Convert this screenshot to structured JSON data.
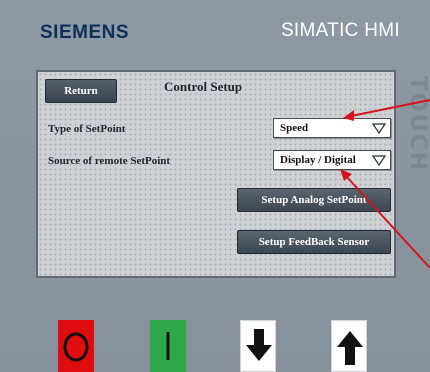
{
  "header": {
    "brand": "SIEMENS",
    "product": "SIMATIC HMI",
    "side_label": "TOUCH"
  },
  "screen": {
    "title": "Control Setup",
    "return_label": "Return",
    "fields": [
      {
        "label": "Type of SetPoint",
        "value": "Speed"
      },
      {
        "label": "Source of remote SetPoint",
        "value": "Display / Digital"
      }
    ],
    "buttons": [
      {
        "label": "Setup Analog SetPoint"
      },
      {
        "label": "Setup FeedBack Sensor"
      }
    ]
  },
  "keys": [
    {
      "name": "stop",
      "icon": "circle-o-icon",
      "color": "#e00d10"
    },
    {
      "name": "start",
      "icon": "bar-i-icon",
      "color": "#2ea74a"
    },
    {
      "name": "down",
      "icon": "arrow-down-icon",
      "color": "#111111"
    },
    {
      "name": "up",
      "icon": "arrow-up-icon",
      "color": "#111111"
    }
  ],
  "colors": {
    "bezel": "#8d98a2",
    "brand": "#0d2f5a",
    "annotation_arrow": "#d4141c"
  }
}
